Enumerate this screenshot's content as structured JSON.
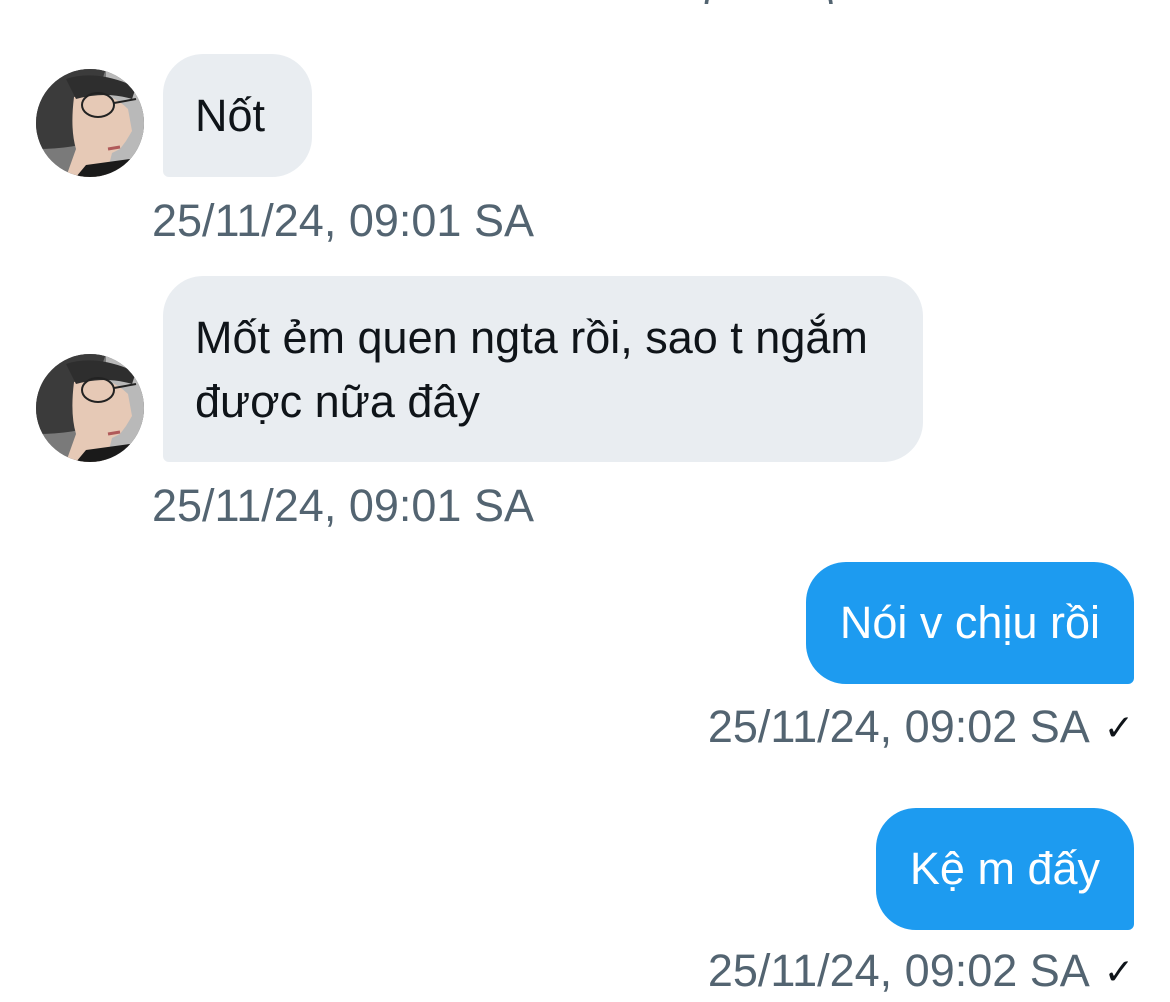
{
  "conversation": {
    "messages": [
      {
        "id": "m1",
        "direction": "incoming",
        "text": "Nốt",
        "timestamp": "25/11/24, 09:01 SA"
      },
      {
        "id": "m2",
        "direction": "incoming",
        "text": "Mốt ẻm quen ngta rồi, sao t ngắm được nữa đây",
        "timestamp": "25/11/24, 09:01 SA"
      },
      {
        "id": "m3",
        "direction": "outgoing",
        "text": "Nói v chịu rồi",
        "timestamp": "25/11/24, 09:02 SA",
        "status_icon": "check-icon",
        "status_glyph": "✓"
      },
      {
        "id": "m4",
        "direction": "outgoing",
        "text": "Kệ m đấy",
        "timestamp": "25/11/24, 09:02 SA",
        "status_icon": "check-icon",
        "status_glyph": "✓"
      }
    ]
  },
  "top_clip": {
    "glyphs": [
      "(",
      ")"
    ]
  },
  "avatar": {
    "icon": "avatar-photo"
  },
  "colors": {
    "incoming_bubble": "#e9edf1",
    "outgoing_bubble": "#1d9bf0",
    "timestamp_text": "#536471",
    "incoming_text": "#0f1419",
    "outgoing_text": "#ffffff"
  }
}
